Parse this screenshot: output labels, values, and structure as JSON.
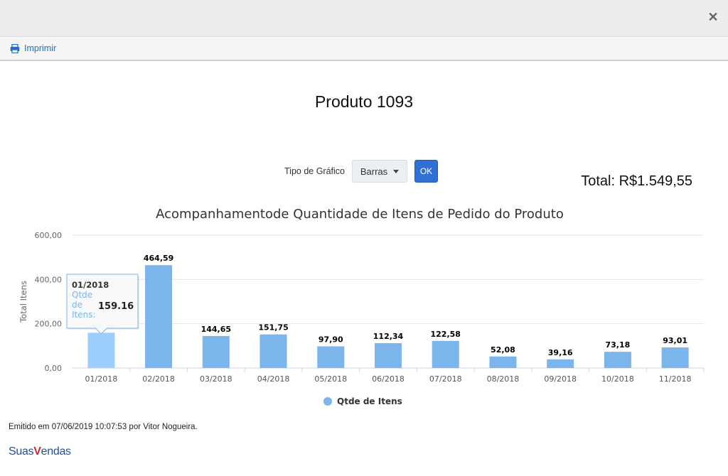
{
  "window": {
    "close_icon": "close-icon"
  },
  "toolbar": {
    "print_label": "Imprimir",
    "print_icon": "printer-icon"
  },
  "page": {
    "title": "Produto 1093"
  },
  "controls": {
    "tipo_label": "Tipo de Gráfico",
    "tipo_value": "Barras",
    "ok_label": "OK"
  },
  "total": {
    "label": "Total: R$1.549,55"
  },
  "chart_data": {
    "type": "bar",
    "title": "Acompanhamentode Quantidade de Itens de Pedido do Produto",
    "xlabel": "",
    "ylabel": "Total Itens",
    "ylim": [
      0,
      600
    ],
    "yticks": [
      "0,00",
      "200,00",
      "400,00",
      "600,00"
    ],
    "categories": [
      "01/2018",
      "02/2018",
      "03/2018",
      "04/2018",
      "05/2018",
      "06/2018",
      "07/2018",
      "08/2018",
      "09/2018",
      "10/2018",
      "11/2018"
    ],
    "series": [
      {
        "name": "Qtde de Itens",
        "values": [
          159.16,
          464.59,
          144.65,
          151.75,
          97.9,
          112.34,
          122.58,
          52.08,
          39.16,
          73.18,
          93.01
        ],
        "labels": [
          "159,16",
          "464,59",
          "144,65",
          "151,75",
          "97,90",
          "112,34",
          "122,58",
          "52,08",
          "39,16",
          "73,18",
          "93,01"
        ],
        "color": "#7cb5ec",
        "hover_color": "#9ccffb"
      }
    ],
    "legend_position": "bottom",
    "grid": true,
    "tooltip": {
      "category": "01/2018",
      "series_label": "Qtde de Itens:",
      "value": "159.16"
    }
  },
  "footer": {
    "emitted": "Emitido em 07/06/2019 10:07:53 por Vitor Nogueira."
  },
  "brand": {
    "part1": "Suas",
    "part2": "V",
    "part3": "endas"
  }
}
